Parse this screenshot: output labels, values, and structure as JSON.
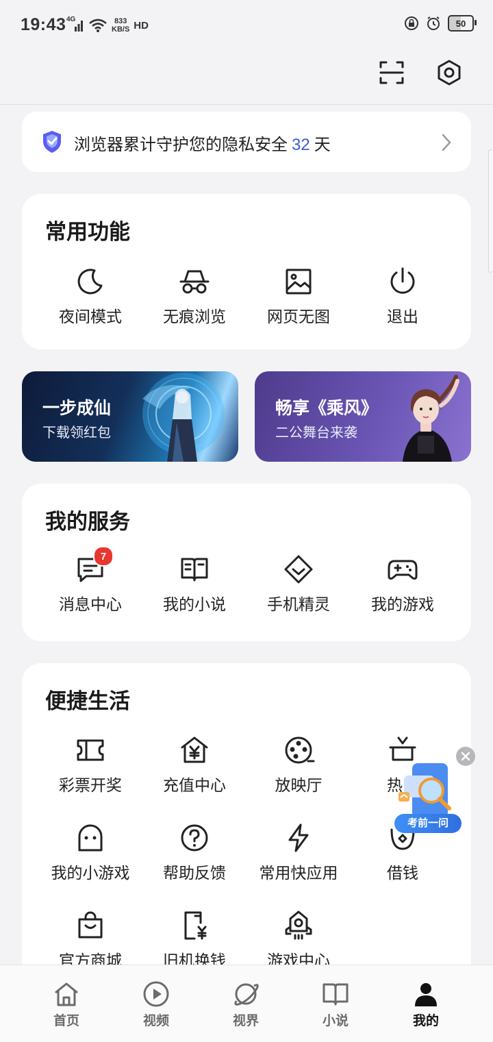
{
  "status_bar": {
    "time": "19:43",
    "network": "4G",
    "speed_value": "833",
    "speed_unit": "KB/S",
    "hd": "HD",
    "battery": "50"
  },
  "privacy": {
    "prefix": "浏览器累计守护您的隐私安全",
    "days": "32",
    "suffix": "天"
  },
  "common": {
    "title": "常用功能",
    "items": [
      {
        "label": "夜间模式",
        "icon": "moon-icon"
      },
      {
        "label": "无痕浏览",
        "icon": "incognito-icon"
      },
      {
        "label": "网页无图",
        "icon": "image-icon"
      },
      {
        "label": "退出",
        "icon": "power-icon"
      }
    ]
  },
  "banners": [
    {
      "title": "一步成仙",
      "subtitle": "下载领红包"
    },
    {
      "title": "畅享《乘风》",
      "subtitle": "二公舞台来袭"
    }
  ],
  "services": {
    "title": "我的服务",
    "items": [
      {
        "label": "消息中心",
        "icon": "message-icon",
        "badge": "7"
      },
      {
        "label": "我的小说",
        "icon": "book-icon"
      },
      {
        "label": "手机精灵",
        "icon": "diamond-icon"
      },
      {
        "label": "我的游戏",
        "icon": "gamepad-icon"
      }
    ]
  },
  "life": {
    "title": "便捷生活",
    "items": [
      {
        "label": "彩票开奖",
        "icon": "ticket-icon"
      },
      {
        "label": "充值中心",
        "icon": "recharge-icon"
      },
      {
        "label": "放映厅",
        "icon": "film-reel-icon"
      },
      {
        "label": "热门",
        "icon": "hot-icon"
      },
      {
        "label": "我的小游戏",
        "icon": "ghost-icon"
      },
      {
        "label": "帮助反馈",
        "icon": "help-icon"
      },
      {
        "label": "常用快应用",
        "icon": "lightning-icon"
      },
      {
        "label": "借钱",
        "icon": "loan-icon"
      },
      {
        "label": "官方商城",
        "icon": "shopping-bag-icon"
      },
      {
        "label": "旧机换钱",
        "icon": "phone-trade-icon"
      },
      {
        "label": "游戏中心",
        "icon": "game-center-icon"
      }
    ]
  },
  "float_widget": {
    "label": "考前一问"
  },
  "bottom_nav": [
    {
      "label": "首页",
      "icon": "home-icon"
    },
    {
      "label": "视频",
      "icon": "play-icon"
    },
    {
      "label": "视界",
      "icon": "planet-icon"
    },
    {
      "label": "小说",
      "icon": "book-open-icon"
    },
    {
      "label": "我的",
      "icon": "person-icon",
      "active": true
    }
  ]
}
